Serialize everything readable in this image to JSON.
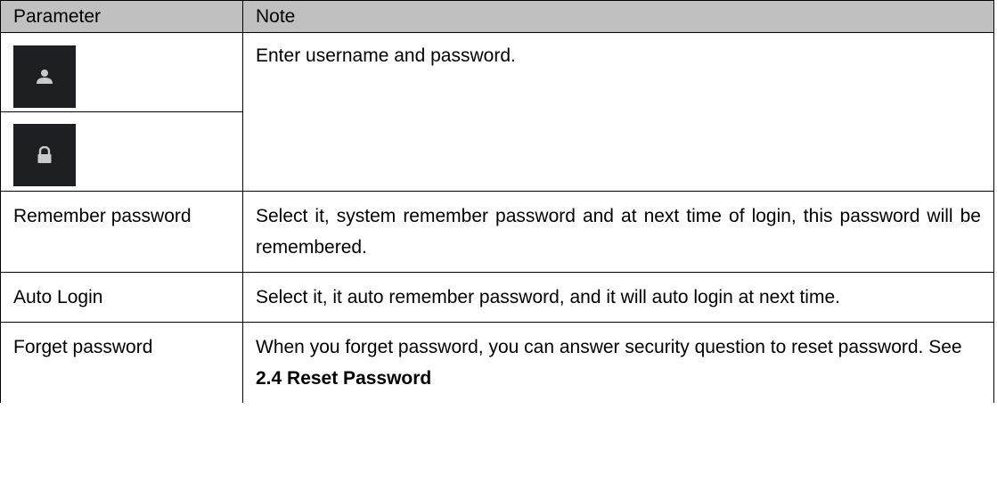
{
  "table": {
    "headers": {
      "parameter": "Parameter",
      "note": "Note"
    },
    "login_fields": {
      "user_icon": "user-icon",
      "lock_icon": "lock-icon",
      "note": "Enter username and password."
    },
    "rows": [
      {
        "parameter": "Remember password",
        "note": "Select it, system remember password and at next time of login, this password will be remembered."
      },
      {
        "parameter": "Auto Login",
        "note": "Select it, it auto remember password, and it will auto login at next time."
      },
      {
        "parameter": "Forget password",
        "note_prefix": "When you forget password, you can answer security question to reset password. See ",
        "note_link": "2.4 Reset Password"
      }
    ]
  },
  "colors": {
    "header_bg": "#c0c0c0",
    "icon_bg": "#1e1f23",
    "icon_fg": "#c9cacf"
  }
}
